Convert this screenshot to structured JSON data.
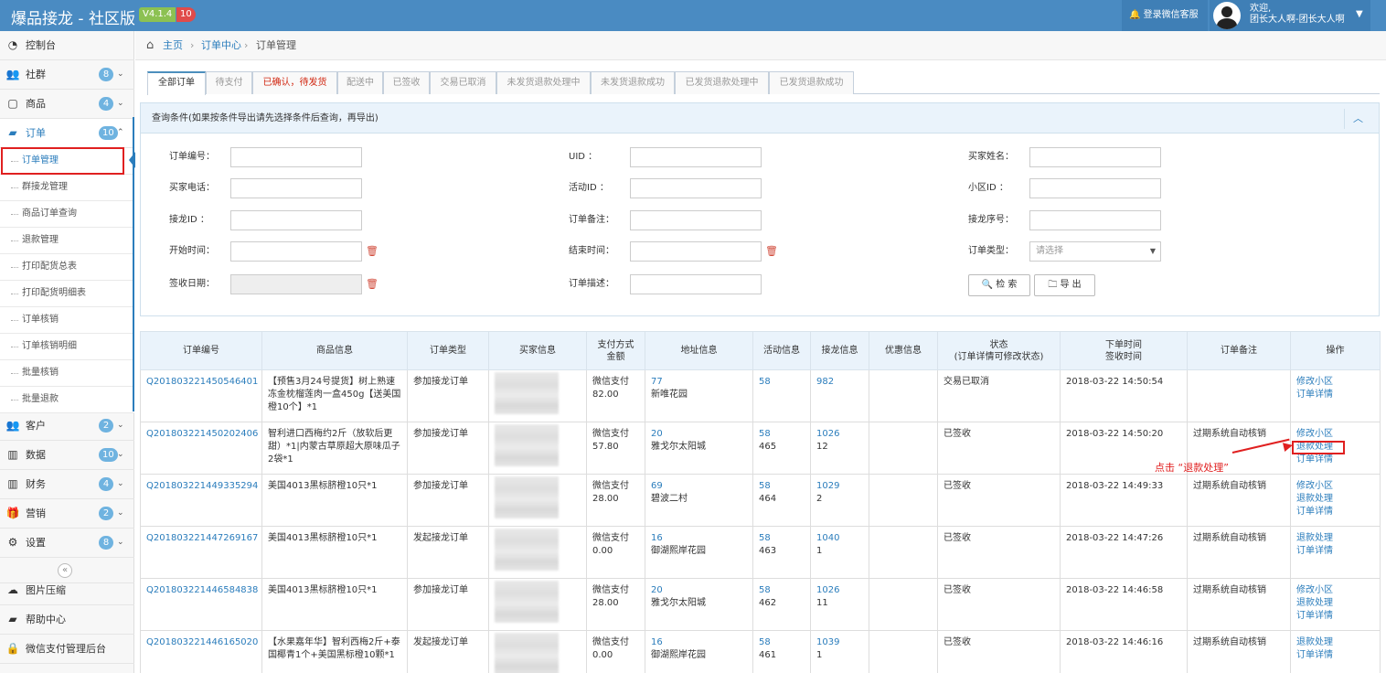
{
  "header": {
    "brand": "爆品接龙 - 社区版",
    "version": "V4.1.4",
    "version_count": "10",
    "login_wechat": "登录微信客服",
    "welcome": "欢迎,",
    "username": "团长大人啊-团长大人啊"
  },
  "sidebar": {
    "items": [
      {
        "label": "控制台",
        "icon": "dashboard-icon"
      },
      {
        "label": "社群",
        "badge": "8",
        "icon": "users-icon"
      },
      {
        "label": "商品",
        "badge": "4",
        "icon": "file-icon"
      },
      {
        "label": "订单",
        "badge": "10",
        "icon": "book-icon"
      }
    ],
    "order_sub": [
      "订单管理",
      "群接龙管理",
      "商品订单查询",
      "退款管理",
      "打印配货总表",
      "打印配货明细表",
      "订单核销",
      "订单核销明细",
      "批量核销",
      "批量退款"
    ],
    "items2": [
      {
        "label": "客户",
        "badge": "2",
        "icon": "users-icon"
      },
      {
        "label": "数据",
        "badge": "10",
        "icon": "chart-icon"
      },
      {
        "label": "财务",
        "badge": "4",
        "icon": "chart-icon"
      },
      {
        "label": "营销",
        "badge": "2",
        "icon": "gift-icon"
      },
      {
        "label": "设置",
        "badge": "8",
        "icon": "gear-icon"
      }
    ],
    "collapse": "«",
    "items3": [
      {
        "label": "图片压缩",
        "icon": "cloud-icon"
      },
      {
        "label": "帮助中心",
        "icon": "book-icon"
      },
      {
        "label": "微信支付管理后台",
        "icon": "lock-icon"
      }
    ]
  },
  "breadcrumb": {
    "home": "主页",
    "level1": "订单中心",
    "current": "订单管理"
  },
  "tabs": [
    "全部订单",
    "待支付",
    "已确认，待发货",
    "配送中",
    "已签收",
    "交易已取消",
    "未发货退款处理中",
    "未发货退款成功",
    "已发货退款处理中",
    "已发货退款成功"
  ],
  "query": {
    "title": "查询条件(如果按条件导出请先选择条件后查询，再导出)",
    "labels": {
      "order_no": "订单编号：",
      "buyer_phone": "买家电话：",
      "jielong_id": "接龙ID ：",
      "start_time": "开始时间：",
      "sign_date": "签收日期：",
      "uid": "UID ：",
      "activity_id": "活动ID ：",
      "order_remark": "订单备注：",
      "end_time": "结束时间：",
      "order_desc": "订单描述：",
      "buyer_name": "买家姓名：",
      "community_id": "小区ID ：",
      "jielong_seq": "接龙序号：",
      "order_type": "订单类型："
    },
    "select_placeholder": "请选择",
    "search_btn": "检 索",
    "export_btn": "导 出"
  },
  "table": {
    "headers": [
      "订单编号",
      "商品信息",
      "订单类型",
      "买家信息",
      "支付方式\n金额",
      "地址信息",
      "活动信息",
      "接龙信息",
      "优惠信息",
      "状态\n(订单详情可修改状态)",
      "下单时间\n签收时间",
      "订单备注",
      "操作"
    ],
    "rows": [
      {
        "id": "Q201803221450546401",
        "goods": "【预售3月24号提货】树上熟速冻金枕榴莲肉一盒450g【送美国橙10个】*1",
        "type": "参加接龙订单",
        "pay": "微信支付",
        "amount": "82.00",
        "addr_no": "77",
        "addr": "新唯花园",
        "act1": "58",
        "act2": "",
        "jl1": "982",
        "jl2": "",
        "status": "交易已取消",
        "time": "2018-03-22 14:50:54",
        "remark": "",
        "ops": [
          "修改小区",
          "订单详情"
        ]
      },
      {
        "id": "Q201803221450202406",
        "goods": "智利进口西梅约2斤（放软后更甜）*1|内蒙古草原超大原味瓜子2袋*1",
        "type": "参加接龙订单",
        "pay": "微信支付",
        "amount": "57.80",
        "addr_no": "20",
        "addr": "雅戈尔太阳城",
        "act1": "58",
        "act2": "465",
        "jl1": "1026",
        "jl2": "12",
        "status": "已签收",
        "time": "2018-03-22 14:50:20",
        "remark": "过期系统自动核销",
        "ops": [
          "修改小区",
          "退款处理",
          "订单详情"
        ]
      },
      {
        "id": "Q201803221449335294",
        "goods": "美国4013黑标脐橙10只*1",
        "type": "参加接龙订单",
        "pay": "微信支付",
        "amount": "28.00",
        "addr_no": "69",
        "addr": "碧波二村",
        "act1": "58",
        "act2": "464",
        "jl1": "1029",
        "jl2": "2",
        "status": "已签收",
        "time": "2018-03-22 14:49:33",
        "remark": "过期系统自动核销",
        "ops": [
          "修改小区",
          "退款处理",
          "订单详情"
        ]
      },
      {
        "id": "Q201803221447269167",
        "goods": "美国4013黑标脐橙10只*1",
        "type": "发起接龙订单",
        "pay": "微信支付",
        "amount": "0.00",
        "addr_no": "16",
        "addr": "御湖熙岸花园",
        "act1": "58",
        "act2": "463",
        "jl1": "1040",
        "jl2": "1",
        "status": "已签收",
        "time": "2018-03-22 14:47:26",
        "remark": "过期系统自动核销",
        "ops": [
          "退款处理",
          "订单详情"
        ]
      },
      {
        "id": "Q201803221446584838",
        "goods": "美国4013黑标脐橙10只*1",
        "type": "参加接龙订单",
        "pay": "微信支付",
        "amount": "28.00",
        "addr_no": "20",
        "addr": "雅戈尔太阳城",
        "act1": "58",
        "act2": "462",
        "jl1": "1026",
        "jl2": "11",
        "status": "已签收",
        "time": "2018-03-22 14:46:58",
        "remark": "过期系统自动核销",
        "ops": [
          "修改小区",
          "退款处理",
          "订单详情"
        ]
      },
      {
        "id": "Q201803221446165020",
        "goods": "【水果嘉年华】智利西梅2斤+泰国椰青1个+美国黑标橙10颗*1",
        "type": "发起接龙订单",
        "pay": "微信支付",
        "amount": "0.00",
        "addr_no": "16",
        "addr": "御湖熙岸花园",
        "act1": "58",
        "act2": "461",
        "jl1": "1039",
        "jl2": "1",
        "status": "已签收",
        "time": "2018-03-22 14:46:16",
        "remark": "过期系统自动核销",
        "ops": [
          "退款处理",
          "订单详情"
        ]
      }
    ]
  },
  "annotation": "点击 “退款处理”"
}
